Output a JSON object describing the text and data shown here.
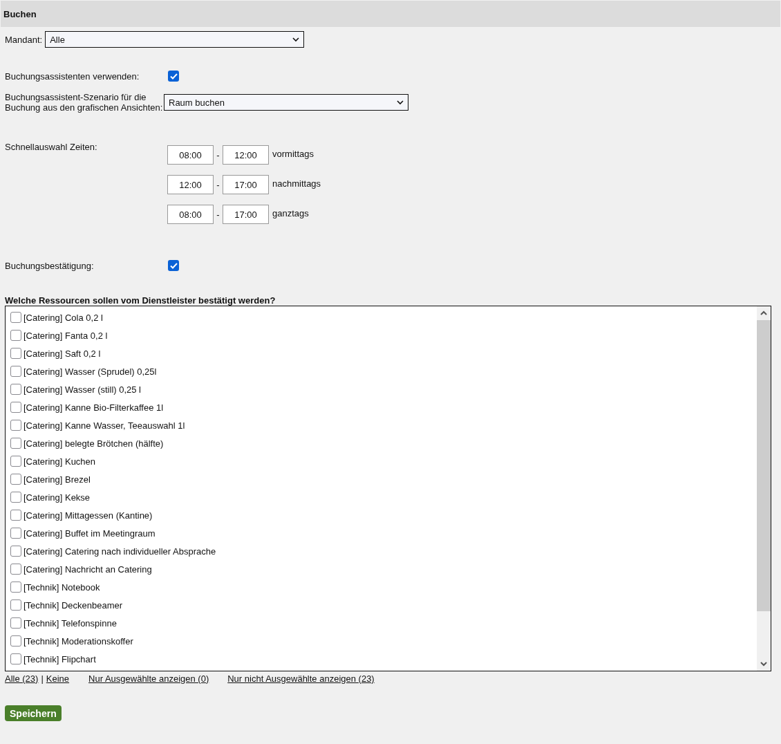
{
  "section": {
    "title": "Buchen"
  },
  "mandant": {
    "label": "Mandant:",
    "value": "Alle"
  },
  "assistant": {
    "label": "Buchungsassistenten verwenden:",
    "checked": true
  },
  "scenario": {
    "label": "Buchungsassistent-Szenario für die Buchung aus den grafischen Ansichten:",
    "value": "Raum buchen"
  },
  "quick_times": {
    "label": "Schnellauswahl Zeiten:",
    "rows": [
      {
        "from": "08:00",
        "separator": "-",
        "to": "12:00",
        "name": "vormittags"
      },
      {
        "from": "12:00",
        "separator": "-",
        "to": "17:00",
        "name": "nachmittags"
      },
      {
        "from": "08:00",
        "separator": "-",
        "to": "17:00",
        "name": "ganztags"
      }
    ]
  },
  "confirmation": {
    "label": "Buchungsbestätigung:",
    "checked": true
  },
  "resources": {
    "question": "Welche Ressourcen sollen vom Dienstleister bestätigt werden?",
    "items": [
      {
        "label": "[Catering] Cola 0,2 l",
        "checked": false
      },
      {
        "label": "[Catering] Fanta 0,2 l",
        "checked": false
      },
      {
        "label": "[Catering] Saft 0,2 l",
        "checked": false
      },
      {
        "label": "[Catering] Wasser (Sprudel) 0,25l",
        "checked": false
      },
      {
        "label": "[Catering] Wasser (still) 0,25 l",
        "checked": false
      },
      {
        "label": "[Catering] Kanne Bio-Filterkaffee 1l",
        "checked": false
      },
      {
        "label": "[Catering] Kanne Wasser, Teeauswahl 1l",
        "checked": false
      },
      {
        "label": "[Catering] belegte Brötchen (hälfte)",
        "checked": false
      },
      {
        "label": "[Catering] Kuchen",
        "checked": false
      },
      {
        "label": "[Catering] Brezel",
        "checked": false
      },
      {
        "label": "[Catering] Kekse",
        "checked": false
      },
      {
        "label": "[Catering] Mittagessen (Kantine)",
        "checked": false
      },
      {
        "label": "[Catering] Buffet im Meetingraum",
        "checked": false
      },
      {
        "label": "[Catering] Catering nach individueller Absprache",
        "checked": false
      },
      {
        "label": "[Catering] Nachricht an Catering",
        "checked": false
      },
      {
        "label": "[Technik] Notebook",
        "checked": false
      },
      {
        "label": "[Technik] Deckenbeamer",
        "checked": false
      },
      {
        "label": "[Technik] Telefonspinne",
        "checked": false
      },
      {
        "label": "[Technik] Moderationskoffer",
        "checked": false
      },
      {
        "label": "[Technik] Flipchart",
        "checked": false
      }
    ]
  },
  "filters": {
    "all": "Alle (23)",
    "separator": "|",
    "none": "Keine",
    "only_selected": "Nur Ausgewählte anzeigen (0)",
    "only_unselected": "Nur nicht Ausgewählte anzeigen (23)"
  },
  "save_button": "Speichern"
}
